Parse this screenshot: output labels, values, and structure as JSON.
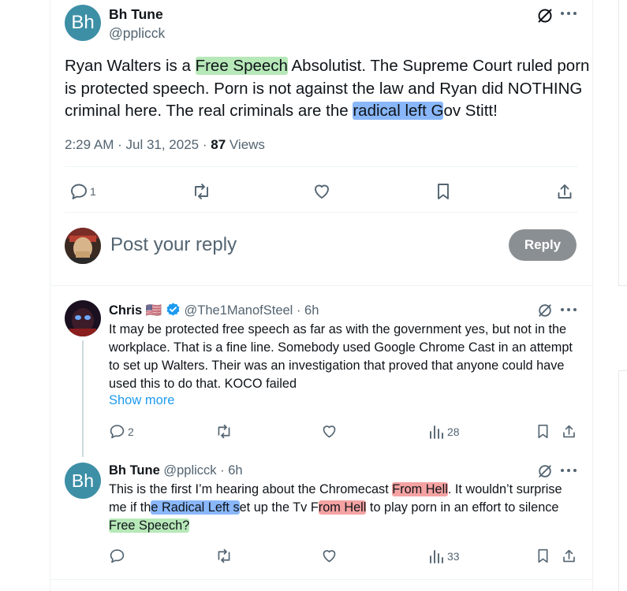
{
  "post": {
    "avatar_initials": "Bh",
    "display_name": "Bh Tune",
    "handle": "@pplicck",
    "text_parts": [
      "Ryan Walters is a ",
      "Free Speech",
      " Absolutist. The Supreme Court ruled porn is protected speech. Porn is not against the law and Ryan did NOTHING criminal here. The real criminals are the ",
      "radical left G",
      "ov Stitt!"
    ],
    "time": "2:29 AM",
    "date": "Jul 31, 2025",
    "views_count": "87",
    "views_label": "Views",
    "reply_count": "1",
    "icons": [
      "grok-icon",
      "more-icon",
      "reply-icon",
      "retweet-icon",
      "like-icon",
      "bookmark-icon",
      "share-icon"
    ]
  },
  "compose": {
    "placeholder": "Post your reply",
    "reply_button": "Reply"
  },
  "replies": [
    {
      "display_name": "Chris",
      "flag": "🇺🇸",
      "handle": "@The1ManofSteel",
      "time": "6h",
      "text": "It may be protected free speech as far as with the government yes, but not in the workplace.  That is a fine line.  Somebody used Google Chrome Cast in an attempt to set up Walters.  Their was an investigation that proved that anyone could have used this to do that.  KOCO failed",
      "show_more": "Show more",
      "reply_count": "2",
      "views_count": "28"
    },
    {
      "avatar_initials": "Bh",
      "display_name": "Bh Tune",
      "handle": "@pplicck",
      "time": "6h",
      "text_parts": [
        "This is the first I’m hearing about the Chromecast ",
        "From Hell",
        ".  It wouldn’t surprise me if th",
        "e Radical Left s",
        "et up the Tv F",
        "rom Hell",
        " to play porn in an effort to silence ",
        "Free Speech?"
      ],
      "views_count": "33"
    }
  ],
  "colors": {
    "text": "#0f1419",
    "muted": "#536471",
    "verified": "#1d9bf0",
    "avatar_bg": "#3d8fa6",
    "reply_button_bg": "#8a8f93",
    "highlight_green": "#7cd67e",
    "highlight_blue": "#4a90f6",
    "highlight_red": "#ee6464"
  }
}
